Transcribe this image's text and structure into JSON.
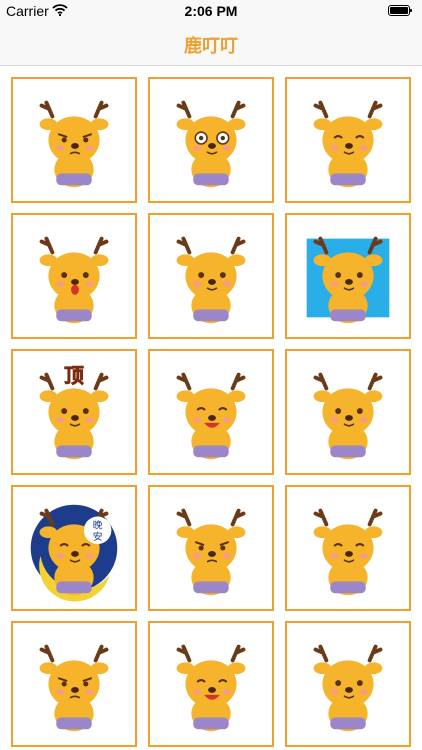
{
  "status_bar": {
    "carrier": "Carrier",
    "time": "2:06 PM"
  },
  "nav": {
    "title": "鹿叮叮"
  },
  "stickers": [
    {
      "name": "sticker-deer-smirk",
      "pose": "frown",
      "bg": null,
      "badge": null
    },
    {
      "name": "sticker-deer-glasses",
      "pose": "surprised",
      "bg": null,
      "badge": null
    },
    {
      "name": "sticker-deer-content",
      "pose": "closed",
      "bg": null,
      "badge": null
    },
    {
      "name": "sticker-deer-shout",
      "pose": "shout",
      "bg": null,
      "badge": null
    },
    {
      "name": "sticker-deer-bottle",
      "pose": "neutral",
      "bg": null,
      "badge": null
    },
    {
      "name": "sticker-deer-swimming",
      "pose": "neutral",
      "bg": "#2aaee8",
      "badge": null
    },
    {
      "name": "sticker-deer-ding",
      "pose": "neutral",
      "bg": null,
      "badge": "顶"
    },
    {
      "name": "sticker-deer-laugh",
      "pose": "laugh",
      "bg": null,
      "badge": null
    },
    {
      "name": "sticker-deer-small",
      "pose": "neutral",
      "bg": null,
      "badge": null
    },
    {
      "name": "sticker-deer-goodnight",
      "pose": "closed",
      "bg": "#1d3d8c",
      "badge": "晚安"
    },
    {
      "name": "sticker-deer-stern",
      "pose": "frown",
      "bg": null,
      "badge": null
    },
    {
      "name": "sticker-deer-bashful",
      "pose": "closed",
      "bg": null,
      "badge": null
    },
    {
      "name": "sticker-deer-annoyed",
      "pose": "frown",
      "bg": null,
      "badge": null
    },
    {
      "name": "sticker-deer-grin",
      "pose": "laugh",
      "bg": null,
      "badge": null
    },
    {
      "name": "sticker-deer-calm",
      "pose": "neutral",
      "bg": null,
      "badge": null
    }
  ],
  "colors": {
    "accent": "#f0a030",
    "deer": "#f6b42c",
    "diaper": "#9a86c9"
  }
}
